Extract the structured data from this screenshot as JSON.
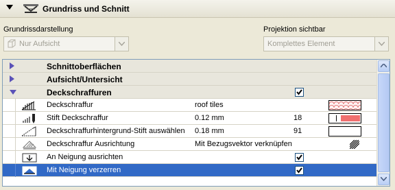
{
  "header": {
    "title": "Grundriss und Schnitt"
  },
  "left_combo": {
    "label": "Grundrissdarstellung",
    "value": "Nur Aufsicht"
  },
  "right_combo": {
    "label": "Projektion sichtbar",
    "value": "Komplettes Element"
  },
  "groups": [
    {
      "label": "Schnittoberflächen"
    },
    {
      "label": "Aufsicht/Untersicht"
    },
    {
      "label": "Deckschraffuren",
      "checked": true
    }
  ],
  "props": [
    {
      "label": "Deckschraffur",
      "value": "roof tiles",
      "icon": "fill-icon"
    },
    {
      "label": "Stift Deckschraffur",
      "value": "0.12 mm",
      "number": "18",
      "icon": "pen-icon"
    },
    {
      "label": "Deckschraffurhintergrund-Stift auswählen",
      "value": "0.18 mm",
      "number": "91",
      "icon": "background-pen-icon"
    },
    {
      "label": "Deckschraffur Ausrichtung",
      "value": "Mit Bezugsvektor verknüpfen",
      "icon": "orientation-icon"
    },
    {
      "label": "An Neigung ausrichten",
      "checked": true,
      "icon": "align-slope-icon"
    },
    {
      "label": "Mit Neigung verzerren",
      "checked": true,
      "icon": "distort-slope-icon"
    }
  ],
  "colors": {
    "selection": "#3169c6",
    "pen_color": "#f07070",
    "accent": "#7f9db9"
  }
}
